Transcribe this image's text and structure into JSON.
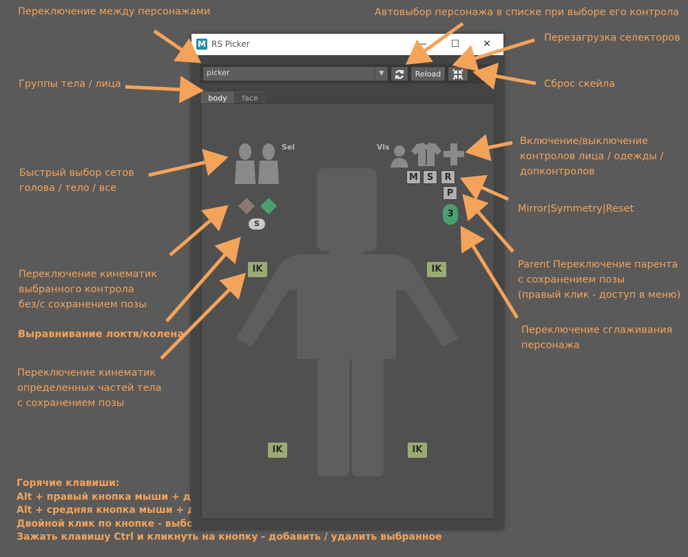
{
  "annotations": {
    "switch_characters": "Переключение между персонажами",
    "autoselect": "Автовыбор персонажа в списке при выборе его контрола",
    "reload_selectors": "Перезагрузка селекторов",
    "body_face_groups": "Группы тела / лица",
    "reset_scale": "Сброс скейла",
    "quick_select_line1": "Быстрый выбор сетов",
    "quick_select_line2": "голова / тело / все",
    "vis_toggle_line1": "Включение/выключение",
    "vis_toggle_line2": "контролов лица / одежды /",
    "vis_toggle_line3": "допконтролов",
    "mirror_symmetry_reset": "Mirror|Symmetry|Reset",
    "kinematic_switch_line1": "Переключение кинематик",
    "kinematic_switch_line2": "выбранного контрола",
    "kinematic_switch_line3": "без/с сохранением позы",
    "parent_line1": "Parent Переключение парента",
    "parent_line2": "с сохранением позы",
    "parent_line3": "(правый клик - доступ в меню)",
    "elbow_knee_align": "Выравнивание локтя/колена",
    "smoothing_line1": "Переключение сглаживания",
    "smoothing_line2": "персонажа",
    "parts_kinematic_line1": "Переключение кинематик",
    "parts_kinematic_line2": "определенных частей тела",
    "parts_kinematic_line3": "с сохранением позы"
  },
  "hotkeys": {
    "title": "Горячие клавиши:",
    "lines": [
      "Alt + правый кнопка мыши + движение - изменение скейла",
      "Alt + средняя кнопка мыши + движение - перемещение",
      "Двойной клик по кнопке - выбор сета (аналог Alt+S)",
      "Зажать клавишу Ctrl и кликнуть на кнопку - добавить / удалить выбранное"
    ]
  },
  "window": {
    "title": "RS Picker",
    "app_icon_letter": "M",
    "minimize_glyph": "—",
    "maximize_glyph": "☐",
    "close_glyph": "✕"
  },
  "toolbar": {
    "character_value": "picker",
    "reload_label": "Reload",
    "icons": [
      "refresh-icon",
      "scale-reset-icon",
      "gear-icon"
    ]
  },
  "tabs": [
    "body",
    "face"
  ],
  "picker": {
    "sel_label": "Sel",
    "vis_label": "Vis",
    "buttons_msr": [
      "M",
      "S",
      "R"
    ],
    "parent_button": "P",
    "smooth_value": "3",
    "ik_label": "IK",
    "s_button": "S"
  },
  "colors": {
    "annotation": "#f4a35a",
    "ik_button": "#9aab74",
    "smooth_pill": "#4aa06e",
    "fk_diamond": "#8a7a74",
    "ik_diamond": "#4aa06e"
  }
}
